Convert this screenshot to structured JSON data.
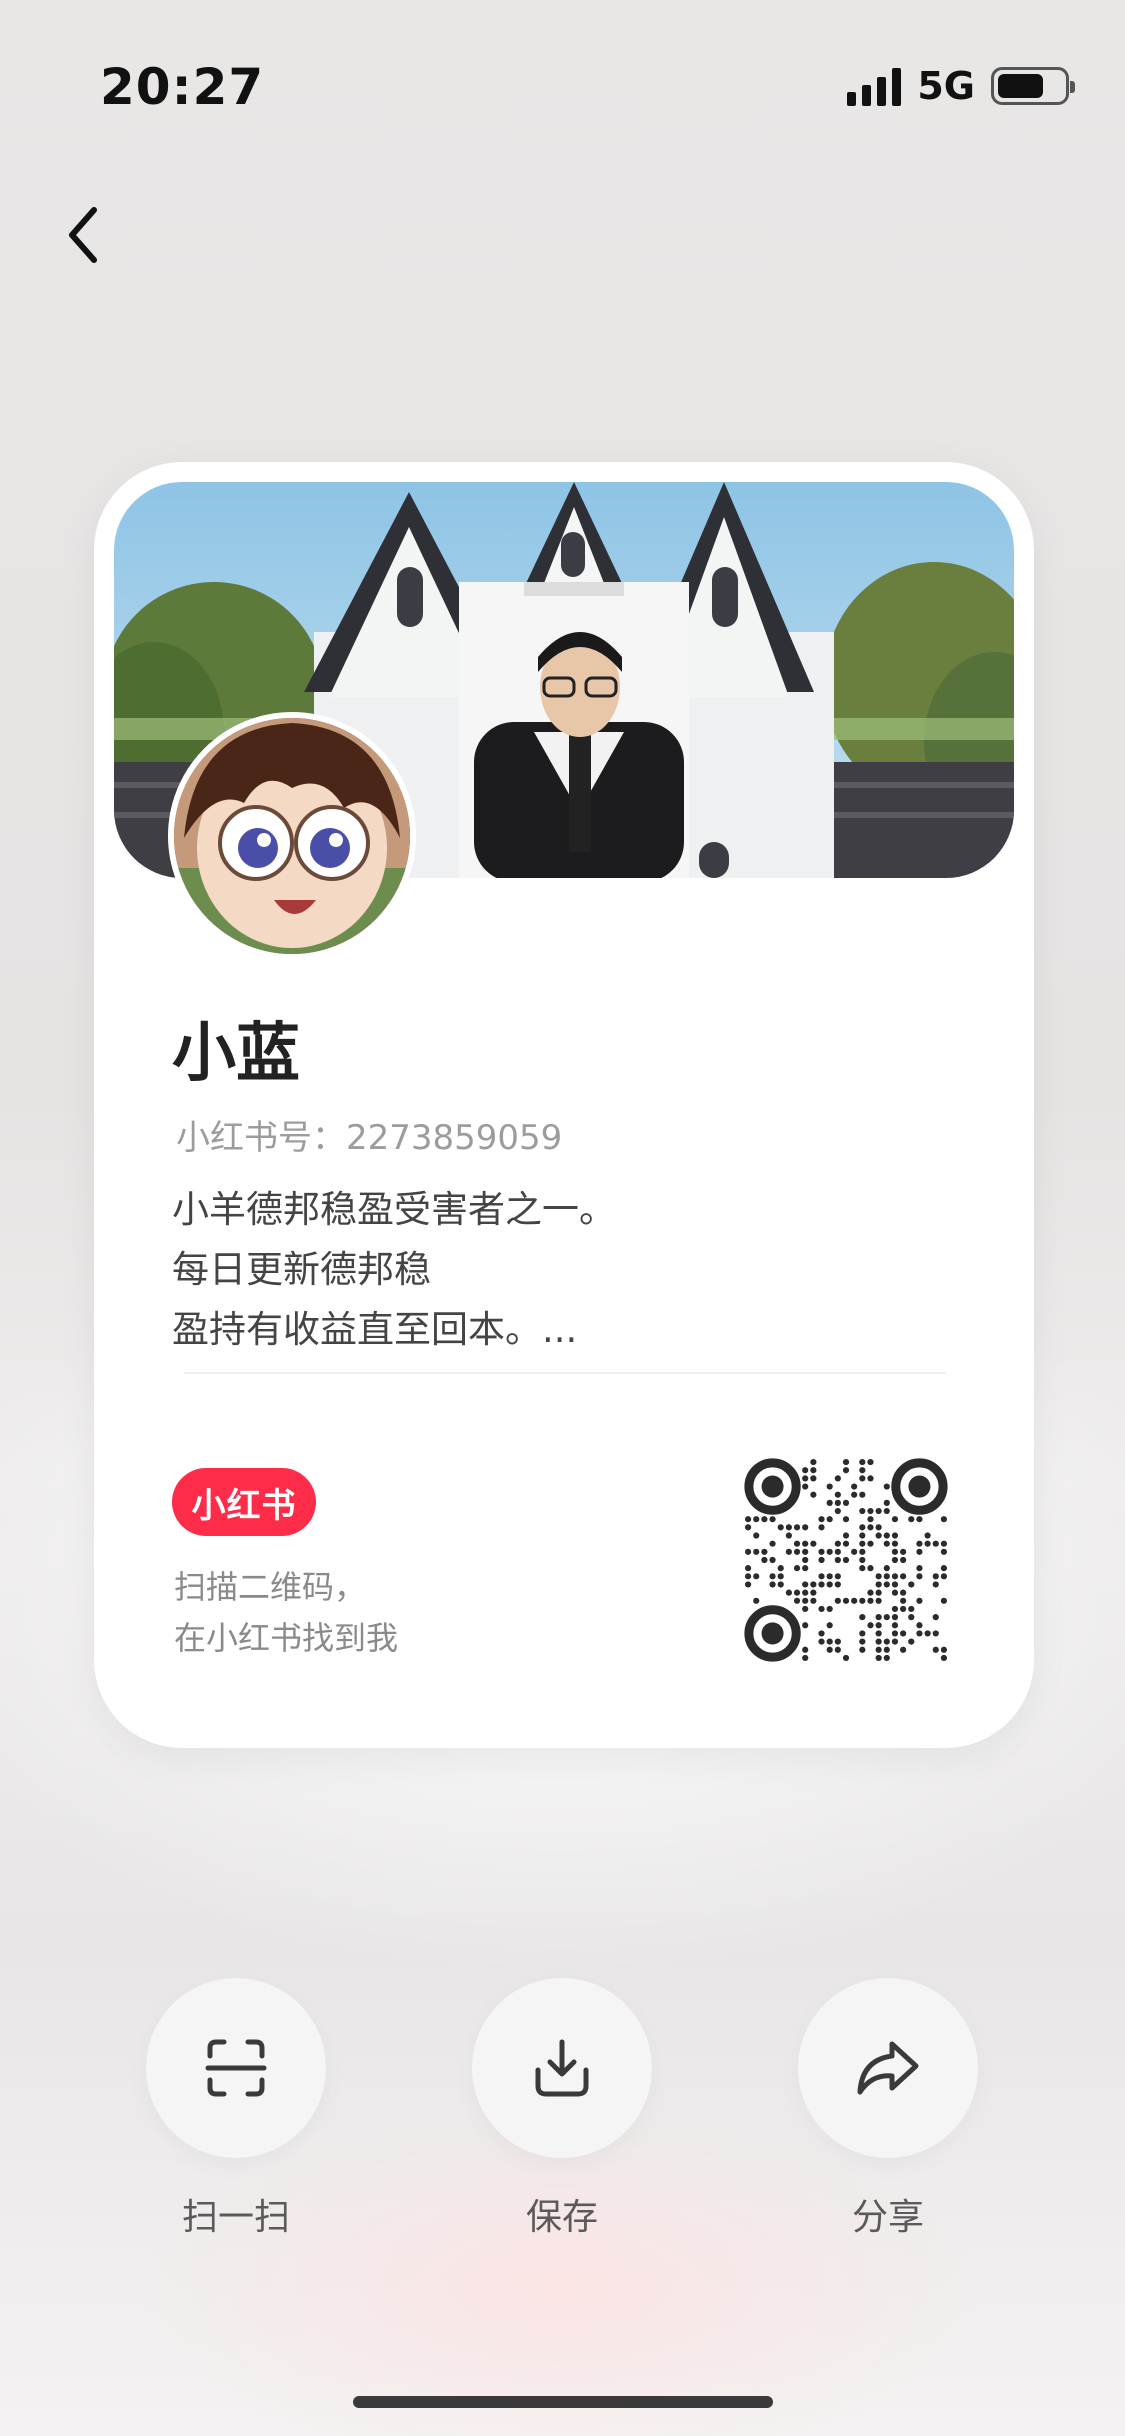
{
  "status": {
    "time": "20:27",
    "network": "5G"
  },
  "card": {
    "name": "小蓝",
    "id_label": "小红书号：2273859059",
    "bio": [
      "小羊德邦稳盈受害者之一。",
      "每日更新德邦稳",
      "盈持有收益直至回本。..."
    ],
    "logo_text": "小红书",
    "scan_tip": [
      "扫描二维码，",
      "在小红书找到我"
    ]
  },
  "actions": [
    {
      "label": "扫一扫",
      "icon": "scan-icon"
    },
    {
      "label": "保存",
      "icon": "download-icon"
    },
    {
      "label": "分享",
      "icon": "share-icon"
    }
  ],
  "colors": {
    "brand": "#fe2c49",
    "card_bg": "#ffffff"
  }
}
